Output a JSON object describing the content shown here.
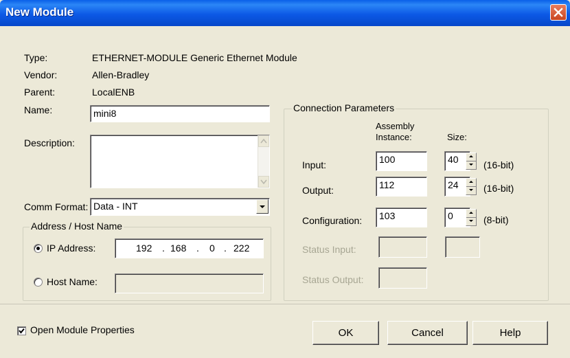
{
  "window": {
    "title": "New Module"
  },
  "module": {
    "type_label": "Type:",
    "type_value": "ETHERNET-MODULE Generic Ethernet Module",
    "vendor_label": "Vendor:",
    "vendor_value": "Allen-Bradley",
    "parent_label": "Parent:",
    "parent_value": "LocalENB",
    "name_label": "Name:",
    "name_value": "mini8",
    "description_label": "Description:",
    "description_value": "",
    "comm_format_label": "Comm Format:",
    "comm_format_value": "Data - INT"
  },
  "address": {
    "group_title": "Address / Host Name",
    "ip_label": "IP Address:",
    "ip_octets": [
      "192",
      "168",
      "0",
      "222"
    ],
    "ip_selected": true,
    "host_label": "Host Name:",
    "host_value": ""
  },
  "connection": {
    "group_title": "Connection Parameters",
    "col_assembly_line1": "Assembly",
    "col_assembly_line2": "Instance:",
    "col_size": "Size:",
    "rows": [
      {
        "label": "Input:",
        "instance": "100",
        "size": "40",
        "unit": "(16-bit)",
        "enabled": true
      },
      {
        "label": "Output:",
        "instance": "112",
        "size": "24",
        "unit": "(16-bit)",
        "enabled": true
      },
      {
        "label": "Configuration:",
        "instance": "103",
        "size": "0",
        "unit": "(8-bit)",
        "enabled": true
      },
      {
        "label": "Status Input:",
        "instance": "",
        "size": "",
        "unit": "",
        "enabled": false
      },
      {
        "label": "Status Output:",
        "instance": "",
        "size": "",
        "unit": "",
        "enabled": false
      }
    ]
  },
  "footer": {
    "open_props_label": "Open Module Properties",
    "open_props_checked": true,
    "ok_label": "OK",
    "cancel_label": "Cancel",
    "help_label": "Help"
  },
  "colors": {
    "title_bar": "#0c59e6",
    "close_button": "#c94520",
    "dialog_bg": "#ece9d8",
    "disabled_text": "#a7a693"
  },
  "icons": [
    "close-icon",
    "scroll-up-icon",
    "scroll-down-icon",
    "dropdown-arrow-icon",
    "spin-up-icon",
    "spin-down-icon",
    "checkmark-icon"
  ]
}
